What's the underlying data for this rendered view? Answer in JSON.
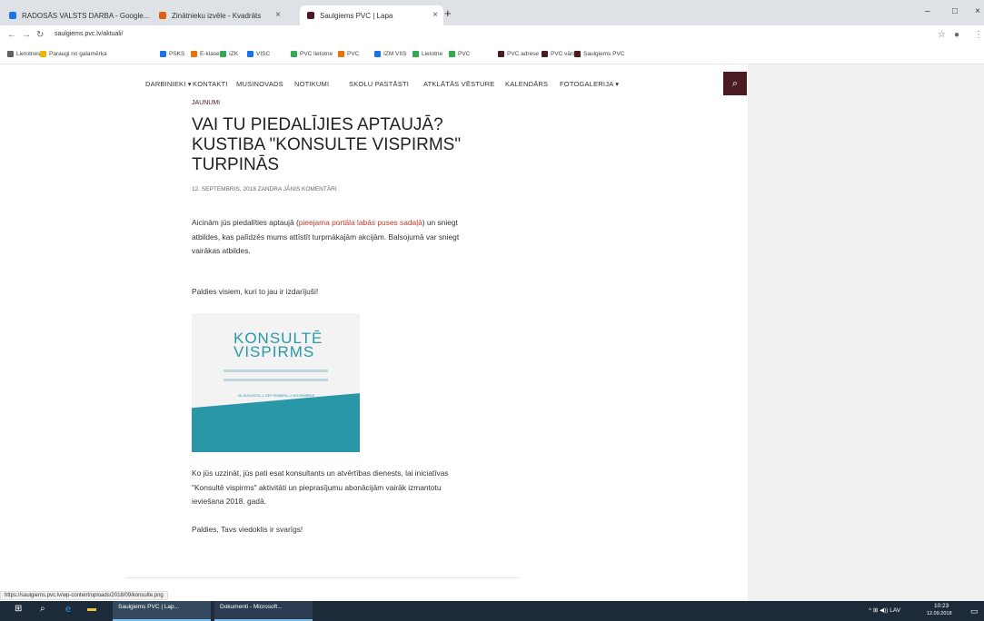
{
  "browser": {
    "tabs": [
      {
        "label": "RADOSĀS VALSTS DARBA - Google...",
        "active": false
      },
      {
        "label": "Zinātnieku izvēle - Kvadrāts",
        "active": false
      },
      {
        "label": "Saulgiems PVC | Lapa",
        "active": true
      }
    ],
    "new_tab": "+",
    "window_controls": {
      "min": "–",
      "max": "□",
      "close": "×"
    },
    "url": "saulgiems.pvc.lv/aktuali/",
    "bookmarks": [
      "Lietotnes",
      "Paraugi no galamērķa",
      "PSKS",
      "E-klase",
      "IZK",
      "VISC",
      "PVC lietotne",
      "PVC",
      "IZM VIIS",
      "Lietotne",
      "PVC",
      "PVC adrese",
      "PVC vārds",
      "Saulgiems PVC"
    ]
  },
  "site": {
    "nav": [
      "DARBINIEKI ▾",
      "KONTAKTI",
      "MUSINOVADS",
      "NOTIKUMI",
      "SKOLU PASTĀSTI",
      "ATKLĀTĀS VĒSTURE",
      "KALENDĀRS",
      "FOTOGALERIJA ▾"
    ],
    "search_icon": "⌕",
    "article": {
      "category": "JAUNUMI",
      "title": "VAI TU PIEDALĪJIES APTAUJĀ? KUSTIBA \"KONSULTE VISPIRMS\" TURPINĀS",
      "meta": "12. SEPTEMBRIS, 2018   ZANDRA JĀNIS   KOMENTĀRI",
      "p1_pre": "Aicinām jūs piedalīties aptaujā (",
      "p1_link": "pieejama portāla labās puses sadaļā",
      "p1_post": ") un sniegt atbildes, kas palīdzēs mums attīstīt turpmākajām akcijām. Balsojumā var sniegt vairākas atbildes.",
      "p2": "Paldies visiem, kuri to jau ir izdarījuši!",
      "poster": {
        "logo_line1": "KONSULTĒ",
        "logo_line2": "VISPIRMS",
        "date_band": "26.AUGUSTA–1.SEPTEMBRA–1.NOVEMBRIS"
      },
      "p3": "Ko jūs uzzināt, jūs pati esat konsultants un atvērtības dienests, lai iniciatīvas \"Konsultē vispirms\" aktivitāti un pieprasījumu abonācijām vairāk izmantotu ieviešana 2018. gadā.",
      "p4": "Paldies, Tavs viedoklis ir svarīgs!"
    },
    "status_url": "https://saulgiems.pvc.lv/wp-content/uploads/2018/09/konsulte.png"
  },
  "taskbar": {
    "apps": [
      "Saulgiems PVC | Lap...",
      "Dokumenti - Microsoft..."
    ],
    "tray": "^ ⊞ ◀)) LAV",
    "time": "10:23",
    "date": "12.09.2018"
  },
  "colors": {
    "accent": "#4a1b22",
    "teal": "#2a97a9",
    "link": "#c0392b"
  }
}
